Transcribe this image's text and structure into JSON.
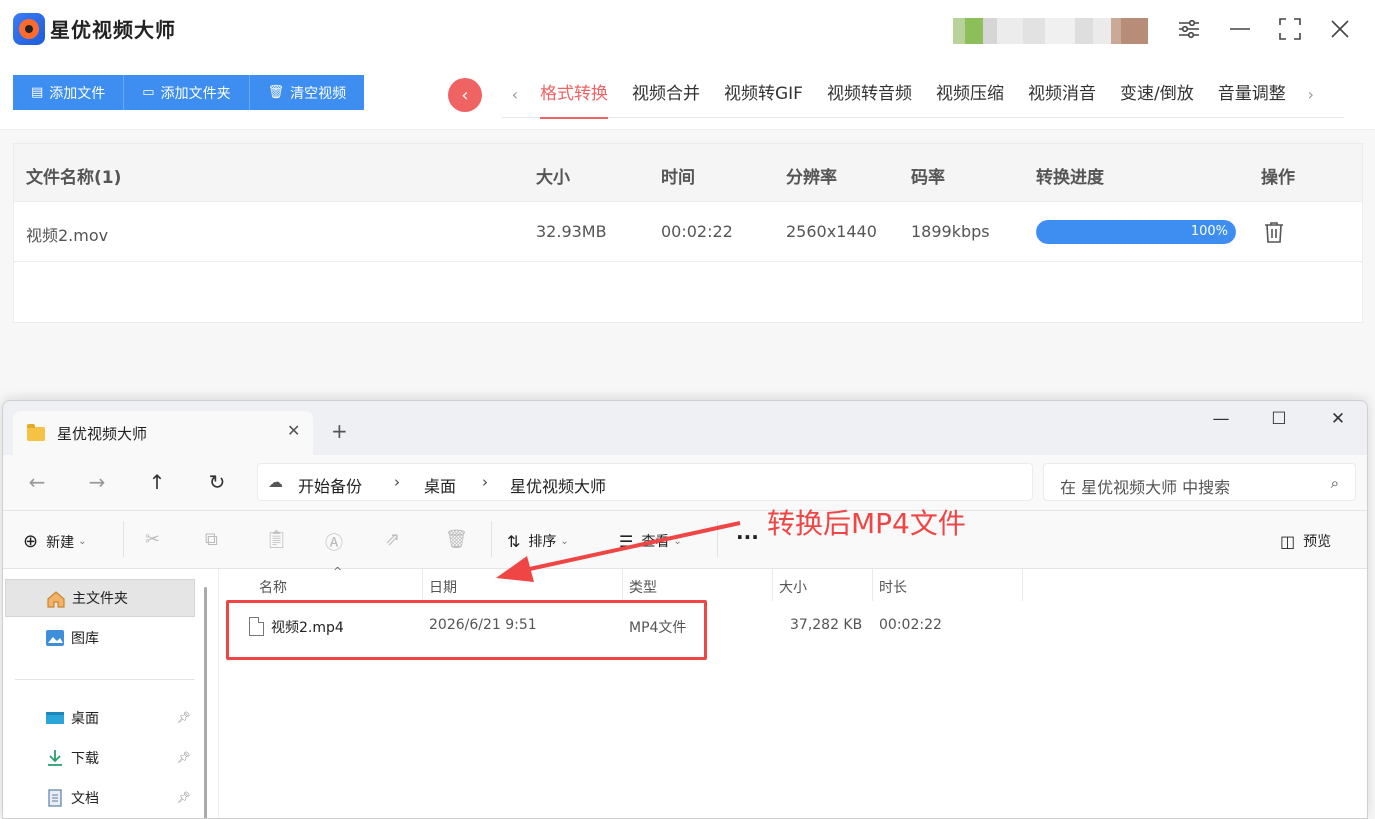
{
  "app": {
    "title": "星优视频大师",
    "toolbar_buttons": [
      "添加文件",
      "添加文件夹",
      "清空视频"
    ],
    "tabs": [
      "格式转换",
      "视频合并",
      "视频转GIF",
      "视频转音频",
      "视频压缩",
      "视频消音",
      "变速/倒放",
      "音量调整"
    ],
    "active_tab": "格式转换",
    "accent_color": "#f06363",
    "button_color": "#3d8ef0"
  },
  "table": {
    "headers": [
      "文件名称(1)",
      "大小",
      "时间",
      "分辨率",
      "码率",
      "转换进度",
      "操作"
    ],
    "rows": [
      {
        "name": "视频2.mov",
        "size": "32.93MB",
        "duration": "00:02:22",
        "resolution": "2560x1440",
        "bitrate": "1899kbps",
        "progress_label": "100%",
        "progress": 1.0
      }
    ]
  },
  "explorer": {
    "tab_title": "星优视频大师",
    "address": [
      "开始备份",
      "桌面",
      "星优视频大师"
    ],
    "search_placeholder": "在 星优视频大师 中搜索",
    "commands": {
      "new": "新建",
      "sort": "排序",
      "view": "查看",
      "more": "···",
      "preview": "预览"
    },
    "sidebar": [
      {
        "label": "主文件夹",
        "icon": "home-icon",
        "selected": true
      },
      {
        "label": "图库",
        "icon": "gallery-icon"
      },
      {
        "label": "桌面",
        "icon": "desktop-icon",
        "pinned": true
      },
      {
        "label": "下载",
        "icon": "download-icon",
        "pinned": true
      },
      {
        "label": "文档",
        "icon": "document-icon",
        "pinned": true
      }
    ],
    "columns": [
      "名称",
      "日期",
      "类型",
      "大小",
      "时长"
    ],
    "files": [
      {
        "name": "视频2.mp4",
        "date": "2026/6/21 9:51",
        "type": "MP4文件",
        "size": "37,282 KB",
        "duration": "00:02:22"
      }
    ]
  },
  "annotation": {
    "text": "转换后MP4文件",
    "color": "#ef4545"
  }
}
